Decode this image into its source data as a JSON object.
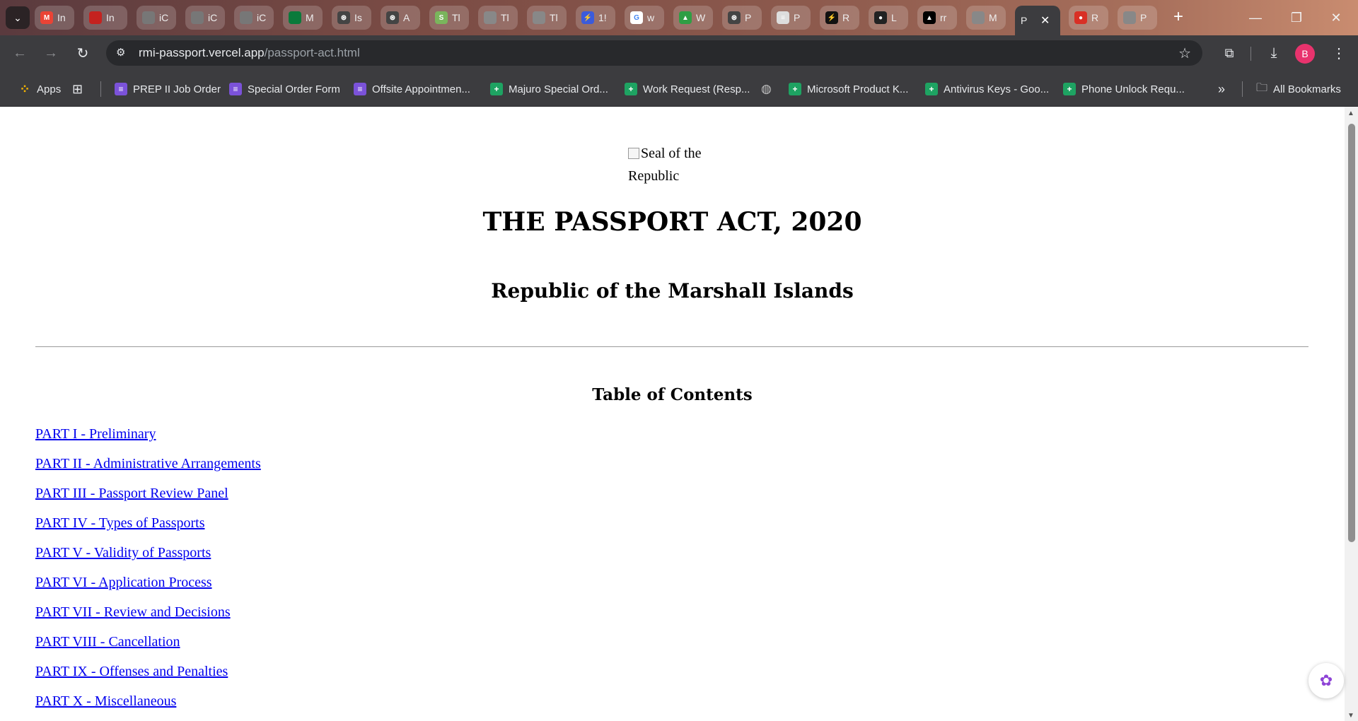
{
  "tabs": [
    {
      "title": "In",
      "icon": "gmail-icon",
      "color": "#ea4335",
      "glyph": "M"
    },
    {
      "title": "In",
      "icon": "mail-count-icon",
      "color": "#c5221f",
      "glyph": "100+"
    },
    {
      "title": "iC",
      "icon": "apple-icon",
      "color": "#777777",
      "glyph": ""
    },
    {
      "title": "iC",
      "icon": "apple-icon",
      "color": "#777777",
      "glyph": ""
    },
    {
      "title": "iC",
      "icon": "apple-icon",
      "color": "#777777",
      "glyph": ""
    },
    {
      "title": "M",
      "icon": "nta-icon",
      "color": "#0a7a3b",
      "glyph": "NTA"
    },
    {
      "title": "Is",
      "icon": "openai-icon",
      "color": "#444444",
      "glyph": "⊛"
    },
    {
      "title": "A",
      "icon": "openai-icon",
      "color": "#444444",
      "glyph": "⊛"
    },
    {
      "title": "Tl",
      "icon": "shopify-icon",
      "color": "#7ab55c",
      "glyph": "S"
    },
    {
      "title": "Tl",
      "icon": "globe-icon",
      "color": "#888888",
      "glyph": ""
    },
    {
      "title": "Tl",
      "icon": "globe-icon",
      "color": "#888888",
      "glyph": ""
    },
    {
      "title": "1!",
      "icon": "bolt-icon",
      "color": "#3b5bdb",
      "glyph": "⚡"
    },
    {
      "title": "w",
      "icon": "google-icon",
      "color": "#ffffff",
      "glyph": "G"
    },
    {
      "title": "W",
      "icon": "image-icon",
      "color": "#2f9e44",
      "glyph": "▲"
    },
    {
      "title": "P",
      "icon": "openai-icon",
      "color": "#444444",
      "glyph": "⊛"
    },
    {
      "title": "P",
      "icon": "document-icon",
      "color": "#dddddd",
      "glyph": "≡"
    },
    {
      "title": "R",
      "icon": "pulse-icon",
      "color": "#111111",
      "glyph": "⚡"
    },
    {
      "title": "L",
      "icon": "github-icon",
      "color": "#222222",
      "glyph": "●"
    },
    {
      "title": "rr",
      "icon": "vercel-icon",
      "color": "#000000",
      "glyph": "▲"
    },
    {
      "title": "M",
      "icon": "globe-icon",
      "color": "#888888",
      "glyph": ""
    },
    {
      "title": "P",
      "icon": "",
      "color": "",
      "glyph": "",
      "active": true
    },
    {
      "title": "R",
      "icon": "record-icon",
      "color": "#d93025",
      "glyph": "●"
    },
    {
      "title": "P",
      "icon": "globe-icon",
      "color": "#888888",
      "glyph": ""
    }
  ],
  "address_bar": {
    "host": "rmi-passport.vercel.app",
    "path": "/passport-act.html"
  },
  "profile": {
    "initial": "B",
    "color": "#e8336d"
  },
  "bookmarks": [
    {
      "label": "Apps",
      "type": "apps"
    },
    {
      "label": "PREP II Job Order",
      "type": "form"
    },
    {
      "label": "Special Order Form",
      "type": "form"
    },
    {
      "label": "Offsite Appointmen...",
      "type": "form"
    },
    {
      "label": "Majuro Special Ord...",
      "type": "sheet"
    },
    {
      "label": "Work Request (Resp...",
      "type": "sheet"
    },
    {
      "label": "Microsoft Product K...",
      "type": "sheet"
    },
    {
      "label": "Antivirus Keys - Goo...",
      "type": "sheet"
    },
    {
      "label": "Phone Unlock Requ...",
      "type": "sheet"
    }
  ],
  "all_bookmarks_label": "All Bookmarks",
  "page": {
    "seal_alt": "Seal of the Republic",
    "title": "THE PASSPORT ACT, 2020",
    "subtitle": "Republic of the Marshall Islands",
    "toc_heading": "Table of Contents",
    "toc": [
      "PART I - Preliminary",
      "PART II - Administrative Arrangements",
      "PART III - Passport Review Panel",
      "PART IV - Types of Passports",
      "PART V - Validity of Passports",
      "PART VI - Application Process",
      "PART VII - Review and Decisions",
      "PART VIII - Cancellation",
      "PART IX - Offenses and Penalties",
      "PART X - Miscellaneous"
    ]
  }
}
